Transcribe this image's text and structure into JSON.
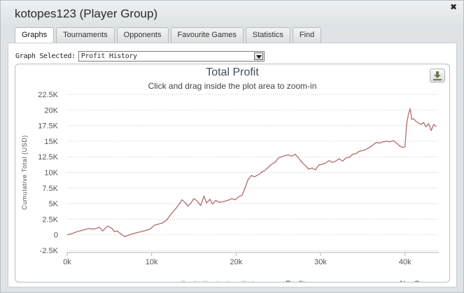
{
  "window": {
    "title": "kotopes123 (Player Group)"
  },
  "tabs": [
    {
      "label": "Graphs",
      "active": true
    },
    {
      "label": "Tournaments",
      "active": false
    },
    {
      "label": "Opponents",
      "active": false
    },
    {
      "label": "Favourite Games",
      "active": false
    },
    {
      "label": "Statistics",
      "active": false
    },
    {
      "label": "Find",
      "active": false
    }
  ],
  "graph_selector": {
    "label": "Graph Selected:",
    "value": "Profit History"
  },
  "icons": {
    "close": "close-icon",
    "export": "download-icon",
    "dropdown": "chevron-down-icon"
  },
  "chart_data": {
    "type": "line",
    "title": "Total Profit",
    "subtitle": "Click and drag inside the plot area to zoom-in",
    "xlabel": "No. Games",
    "ylabel": "Cumulative Total (USD)",
    "xlim": [
      0,
      44000
    ],
    "ylim": [
      -2500,
      22500
    ],
    "x_ticks": [
      "0k",
      "10k",
      "20k",
      "30k",
      "40k"
    ],
    "x_tick_values": [
      0,
      10000,
      20000,
      30000,
      40000
    ],
    "y_ticks": [
      "-2.5K",
      "0",
      "2.5K",
      "5K",
      "7.5K",
      "10K",
      "12.5K",
      "15K",
      "17.5K",
      "20K",
      "22.5K"
    ],
    "y_tick_values": [
      -2500,
      0,
      2500,
      5000,
      7500,
      10000,
      12500,
      15000,
      17500,
      20000,
      22500
    ],
    "grid": "horizontal dotted",
    "legend_position": "bottom-center",
    "series": [
      {
        "name": "Profit Excluding Rake",
        "color": "#d8d8d8",
        "x": [],
        "y": []
      },
      {
        "name": "Profit",
        "color": "#b26b6b",
        "x": [
          0,
          600,
          1200,
          2000,
          2600,
          3200,
          3800,
          4200,
          4800,
          5300,
          5600,
          5900,
          6300,
          6800,
          7400,
          8000,
          8600,
          9200,
          9800,
          10300,
          10800,
          11300,
          11800,
          12300,
          12800,
          13200,
          13600,
          14000,
          14300,
          14600,
          15000,
          15400,
          15800,
          16200,
          16500,
          16900,
          17200,
          17600,
          18000,
          18500,
          19000,
          19500,
          19900,
          20300,
          20700,
          21000,
          21400,
          21800,
          22200,
          22600,
          23000,
          23400,
          23800,
          24200,
          24600,
          25000,
          25400,
          25800,
          26200,
          26600,
          27000,
          27400,
          27800,
          28200,
          28600,
          29000,
          29400,
          29800,
          30200,
          30600,
          31000,
          31400,
          31800,
          32200,
          32600,
          33000,
          33400,
          33800,
          34200,
          34600,
          35000,
          35400,
          35800,
          36200,
          36600,
          37000,
          37400,
          37800,
          38200,
          38600,
          39000,
          39400,
          39700,
          40000,
          40200,
          40400,
          40600,
          40800,
          41000,
          41300,
          41600,
          41900,
          42200,
          42500,
          42800,
          43100,
          43400,
          43700
        ],
        "y": [
          0,
          200,
          500,
          800,
          1000,
          900,
          1200,
          600,
          1400,
          1000,
          500,
          600,
          200,
          -300,
          0,
          250,
          450,
          650,
          900,
          1500,
          1700,
          1900,
          2400,
          3300,
          4100,
          4800,
          5600,
          5100,
          4600,
          5000,
          5800,
          5400,
          4700,
          6200,
          5100,
          5700,
          4900,
          5500,
          5200,
          5300,
          5500,
          5800,
          5600,
          6100,
          6300,
          7300,
          8800,
          9500,
          9300,
          9600,
          10000,
          10300,
          10800,
          11300,
          11600,
          12300,
          12500,
          12700,
          12800,
          12600,
          12900,
          12300,
          11600,
          11100,
          10500,
          10700,
          10400,
          11200,
          11300,
          11500,
          11900,
          11600,
          11800,
          12200,
          11800,
          12300,
          12400,
          12900,
          13000,
          13400,
          13500,
          13700,
          14000,
          14400,
          14800,
          14700,
          14900,
          15000,
          14900,
          15100,
          14700,
          14200,
          14000,
          14100,
          17800,
          19300,
          20200,
          18500,
          18600,
          18200,
          17900,
          17700,
          18000,
          17300,
          17800,
          16700,
          17700,
          17300
        ]
      }
    ]
  }
}
